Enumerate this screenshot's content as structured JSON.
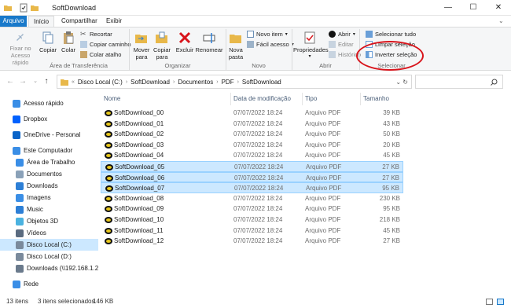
{
  "window": {
    "title": "SoftDownload"
  },
  "window_controls": {
    "minimize": "—",
    "maximize": "☐",
    "close": "✕"
  },
  "tabs": [
    {
      "label": "Arquivo"
    },
    {
      "label": "Início"
    },
    {
      "label": "Compartilhar"
    },
    {
      "label": "Exibir"
    }
  ],
  "ribbon": {
    "clipboard": {
      "pin": "Fixar no Acesso rápido",
      "copy": "Copiar",
      "paste": "Colar",
      "cut": "Recortar",
      "copy_path": "Copiar caminho",
      "paste_shortcut": "Colar atalho",
      "label": "Área de Transferência"
    },
    "organize": {
      "move_to": "Mover para",
      "copy_to": "Copiar para",
      "delete": "Excluir",
      "rename": "Renomear",
      "label": "Organizar"
    },
    "new": {
      "new_folder": "Nova pasta",
      "new_item": "Novo item",
      "easy_access": "Fácil acesso",
      "label": "Novo"
    },
    "open": {
      "properties": "Propriedades",
      "open": "Abrir",
      "edit": "Editar",
      "history": "Histórico",
      "label": "Abrir"
    },
    "select": {
      "select_all": "Selecionar tudo",
      "clear_selection": "Limpar seleção",
      "invert_selection": "Inverter seleção",
      "label": "Selecionar"
    }
  },
  "address": {
    "path": [
      "Disco Local (C:)",
      "SoftDownload",
      "Documentos",
      "PDF",
      "SoftDownload"
    ]
  },
  "nav_pane": [
    {
      "label": "Acesso rápido",
      "icon": "star-icon",
      "color": "#3a8ee6"
    },
    {
      "label": "Dropbox",
      "icon": "dropbox-icon",
      "color": "#0061fe"
    },
    {
      "label": "OneDrive - Personal",
      "icon": "cloud-icon",
      "color": "#0a64c8"
    },
    {
      "label": "Este Computador",
      "icon": "computer-icon",
      "color": "#3a8ee6"
    },
    {
      "label": "Área de Trabalho",
      "icon": "desktop-icon",
      "color": "#3a8ee6"
    },
    {
      "label": "Documentos",
      "icon": "documents-icon",
      "color": "#8aa1b8"
    },
    {
      "label": "Downloads",
      "icon": "download-icon",
      "color": "#2d7fd6"
    },
    {
      "label": "Imagens",
      "icon": "pictures-icon",
      "color": "#3a8ee6"
    },
    {
      "label": "Music",
      "icon": "music-icon",
      "color": "#2d7fd6"
    },
    {
      "label": "Objetos 3D",
      "icon": "objects3d-icon",
      "color": "#4ab2e0"
    },
    {
      "label": "Vídeos",
      "icon": "videos-icon",
      "color": "#5a6b80"
    },
    {
      "label": "Disco Local (C:)",
      "icon": "drive-icon",
      "color": "#7a8a9c"
    },
    {
      "label": "Disco Local (D:)",
      "icon": "drive-icon",
      "color": "#7a8a9c"
    },
    {
      "label": "Downloads (\\\\192.168.1.2",
      "icon": "network-drive-icon",
      "color": "#6a7a8c"
    },
    {
      "label": "Rede",
      "icon": "network-icon",
      "color": "#3a8ee6"
    }
  ],
  "columns": {
    "name": "Nome",
    "date": "Data de modificação",
    "type": "Tipo",
    "size": "Tamanho"
  },
  "files": [
    {
      "name": "SoftDownload_00",
      "date": "07/07/2022 18:24",
      "type": "Arquivo PDF",
      "size": "39 KB"
    },
    {
      "name": "SoftDownload_01",
      "date": "07/07/2022 18:24",
      "type": "Arquivo PDF",
      "size": "43 KB"
    },
    {
      "name": "SoftDownload_02",
      "date": "07/07/2022 18:24",
      "type": "Arquivo PDF",
      "size": "50 KB"
    },
    {
      "name": "SoftDownload_03",
      "date": "07/07/2022 18:24",
      "type": "Arquivo PDF",
      "size": "20 KB"
    },
    {
      "name": "SoftDownload_04",
      "date": "07/07/2022 18:24",
      "type": "Arquivo PDF",
      "size": "45 KB"
    },
    {
      "name": "SoftDownload_05",
      "date": "07/07/2022 18:24",
      "type": "Arquivo PDF",
      "size": "27 KB"
    },
    {
      "name": "SoftDownload_06",
      "date": "07/07/2022 18:24",
      "type": "Arquivo PDF",
      "size": "27 KB"
    },
    {
      "name": "SoftDownload_07",
      "date": "07/07/2022 18:24",
      "type": "Arquivo PDF",
      "size": "95 KB"
    },
    {
      "name": "SoftDownload_08",
      "date": "07/07/2022 18:24",
      "type": "Arquivo PDF",
      "size": "230 KB"
    },
    {
      "name": "SoftDownload_09",
      "date": "07/07/2022 18:24",
      "type": "Arquivo PDF",
      "size": "95 KB"
    },
    {
      "name": "SoftDownload_10",
      "date": "07/07/2022 18:24",
      "type": "Arquivo PDF",
      "size": "218 KB"
    },
    {
      "name": "SoftDownload_11",
      "date": "07/07/2022 18:24",
      "type": "Arquivo PDF",
      "size": "45 KB"
    },
    {
      "name": "SoftDownload_12",
      "date": "07/07/2022 18:24",
      "type": "Arquivo PDF",
      "size": "27 KB"
    }
  ],
  "selected_nav": "Disco Local (C:)",
  "selected_rows": [
    5,
    6,
    7
  ],
  "status": {
    "items": "13 itens",
    "selected": "3 itens selecionados",
    "size": "146 KB"
  },
  "colors": {
    "file_tab": "#1979ca",
    "selection": "#cce8ff",
    "annotation": "#d8141b"
  }
}
